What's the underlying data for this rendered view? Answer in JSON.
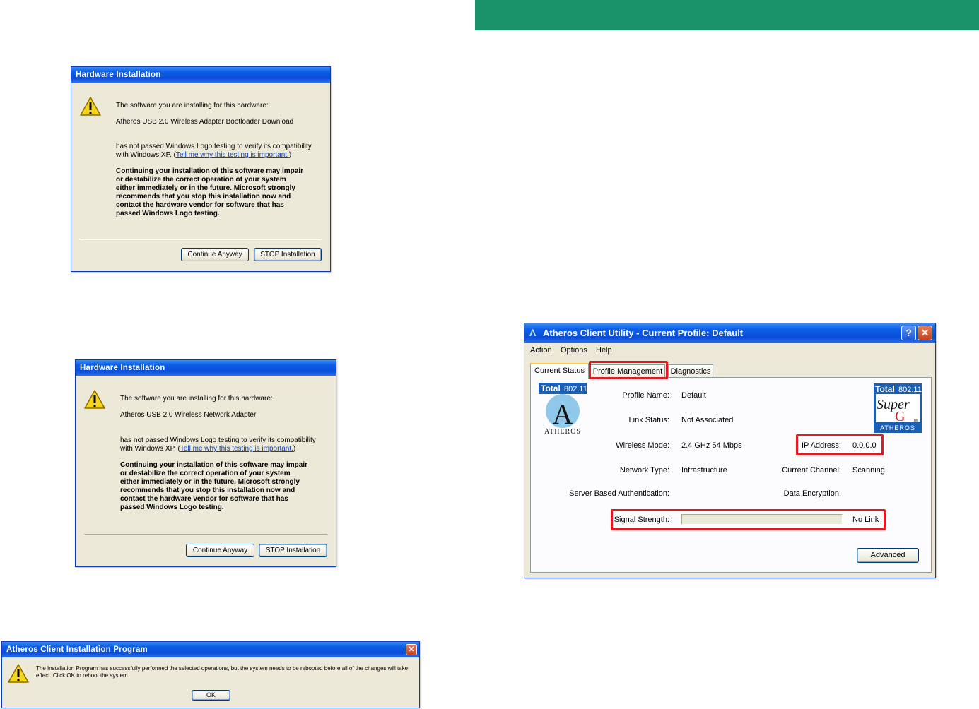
{
  "dialog1": {
    "title": "Hardware Installation",
    "intro": "The software you are installing for this hardware:",
    "device": "Atheros USB 2.0 Wireless Adapter Bootloader Download",
    "not_passed": "has not passed Windows Logo testing to verify its compatibility",
    "with_xp": "with Windows XP. (",
    "link": "Tell me why this testing is important.",
    "close_paren": ")",
    "warning": [
      "Continuing your installation of this software may impair",
      "or destabilize the correct operation of your system",
      "either immediately or in the future. Microsoft strongly",
      "recommends that you stop this installation now and",
      "contact the hardware vendor for software that has",
      "passed Windows Logo testing."
    ],
    "continue_button": "Continue Anyway",
    "stop_button": "STOP Installation"
  },
  "dialog2": {
    "title": "Hardware Installation",
    "intro": "The software you are installing for this hardware:",
    "device": "Atheros USB 2.0 Wireless Network Adapter",
    "not_passed": "has not passed Windows Logo testing to verify its compatibility",
    "with_xp": "with Windows XP. (",
    "link": "Tell me why this testing is important.",
    "close_paren": ")",
    "warning": [
      "Continuing your installation of this software may impair",
      "or destabilize the correct operation of your system",
      "either immediately or in the future. Microsoft strongly",
      "recommends that you stop this installation now and",
      "contact the hardware vendor for software that has",
      "passed Windows Logo testing."
    ],
    "continue_button": "Continue Anyway",
    "stop_button": "STOP Installation"
  },
  "dialog3": {
    "title": "Atheros Client Installation Program",
    "message_line1": "The Installation Program has successfully performed the selected operations, but the system needs to be rebooted before all of the changes will take",
    "message_line2": "effect.  Click OK to reboot the system.",
    "ok_button": "OK"
  },
  "utility": {
    "title": "Atheros Client Utility - Current Profile: Default",
    "help_glyph": "?",
    "close_glyph": "✕",
    "menu": [
      "Action",
      "Options",
      "Help"
    ],
    "tabs": [
      "Current Status",
      "Profile Management",
      "Diagnostics"
    ],
    "logo_left": {
      "total": "Total",
      "std": "802.11",
      "letter": "A",
      "brand": "ATHEROS"
    },
    "logo_right": {
      "total": "Total",
      "std": "802.11",
      "super": "Super",
      "g": "G",
      "brand": "ATHEROS",
      "tm": "TM"
    },
    "profile_name_label": "Profile Name:",
    "profile_name": "Default",
    "link_status_label": "Link Status:",
    "link_status": "Not Associated",
    "wireless_mode_label": "Wireless Mode:",
    "wireless_mode": "2.4 GHz 54 Mbps",
    "ip_label": "IP Address:",
    "ip": "0.0.0.0",
    "network_type_label": "Network Type:",
    "network_type": "Infrastructure",
    "channel_label": "Current Channel:",
    "channel": "Scanning",
    "server_auth_label": "Server Based Authentication:",
    "encryption_label": "Data Encryption:",
    "signal_label": "Signal Strength:",
    "signal_level": 0,
    "signal_text": "No Link",
    "advanced_button": "Advanced"
  }
}
